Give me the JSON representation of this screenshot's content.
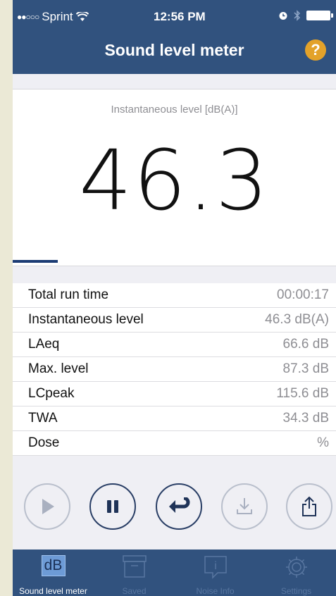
{
  "status_bar": {
    "signal_dots": "●●○○○",
    "carrier": "Sprint",
    "time": "12:56 PM"
  },
  "nav": {
    "title": "Sound level meter",
    "help_label": "?"
  },
  "level": {
    "caption": "Instantaneous level [dB(A)]",
    "value": "46.3",
    "bar_fraction": 0.14
  },
  "stats": [
    {
      "label": "Total run time",
      "value": "00:00:17"
    },
    {
      "label": "Instantaneous level",
      "value": "46.3 dB(A)"
    },
    {
      "label": "LAeq",
      "value": "66.6 dB"
    },
    {
      "label": "Max. level",
      "value": "87.3 dB"
    },
    {
      "label": "LCpeak",
      "value": "115.6 dB"
    },
    {
      "label": "TWA",
      "value": "34.3 dB"
    },
    {
      "label": "Dose",
      "value": "%"
    }
  ],
  "controls": [
    {
      "name": "play",
      "icon": "play-icon",
      "enabled": false
    },
    {
      "name": "pause",
      "icon": "pause-icon",
      "enabled": true
    },
    {
      "name": "reset",
      "icon": "return-icon",
      "enabled": true
    },
    {
      "name": "save",
      "icon": "download-icon",
      "enabled": false
    },
    {
      "name": "share",
      "icon": "share-icon",
      "enabled": false
    }
  ],
  "tabs": [
    {
      "label": "Sound level meter",
      "icon_text": "dB",
      "selected": true
    },
    {
      "label": "Saved",
      "selected": false
    },
    {
      "label": "Noise Info",
      "icon_text": "i",
      "selected": false
    },
    {
      "label": "Settings",
      "selected": false
    }
  ],
  "colors": {
    "bar_bg": "#31527e",
    "accent_dark": "#2a3f66",
    "help": "#e3a22a",
    "disabled": "#b9bfcc"
  }
}
